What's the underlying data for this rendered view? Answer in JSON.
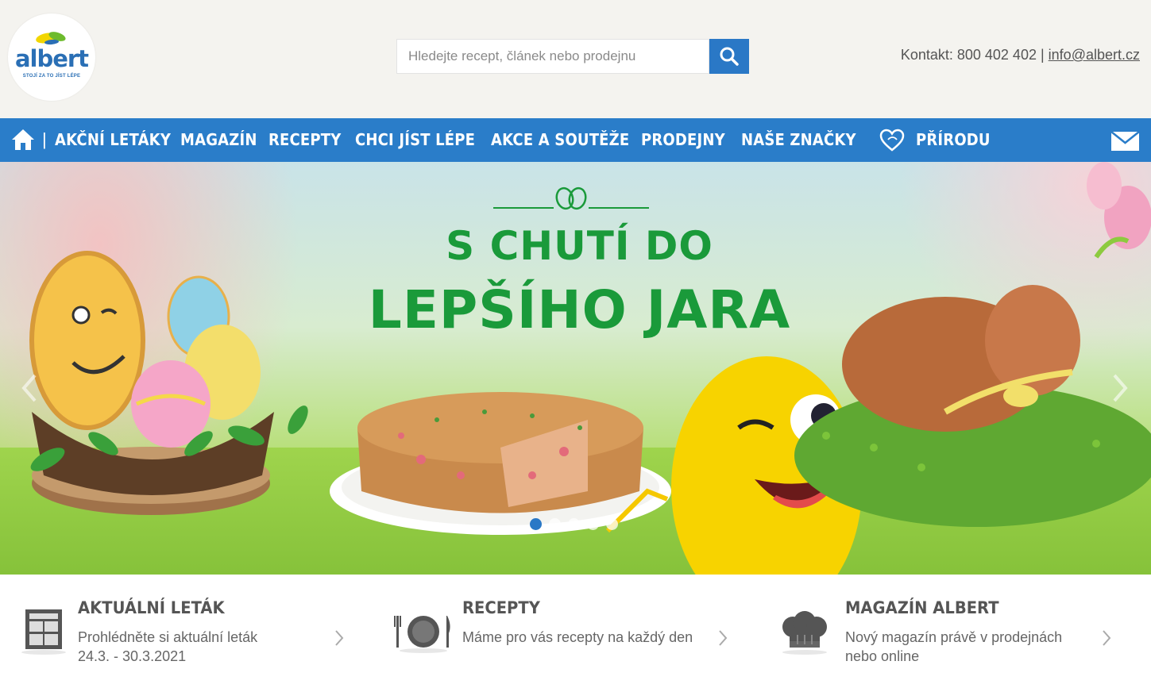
{
  "header": {
    "logo_word": "albert",
    "logo_tagline": "STOJÍ ZA TO JÍST LÉPE",
    "search_placeholder": "Hledejte recept, článek nebo prodejnu",
    "contact_label": "Kontakt: 800 402 402 |",
    "contact_email": "info@albert.cz"
  },
  "nav": {
    "separator": "|",
    "items": [
      "AKČNÍ LETÁKY",
      "MAGAZÍN",
      "RECEPTY",
      "CHCI JÍST LÉPE",
      "AKCE A SOUTĚŽE",
      "PRODEJNY",
      "NAŠE ZNAČKY",
      "PŘÍRODU"
    ]
  },
  "hero": {
    "title_line1": "S CHUTÍ DO",
    "title_line2": "LEPŠÍHO JARA",
    "slide_count": 5,
    "active_slide": 1,
    "title_color": "#1a9a3a"
  },
  "features": [
    {
      "icon": "flyer-icon",
      "title": "AKTUÁLNÍ LETÁK",
      "desc_line1": "Prohlédněte si aktuální leták",
      "desc_line2": "24.3. - 30.3.2021"
    },
    {
      "icon": "plate-cutlery-icon",
      "title": "RECEPTY",
      "desc_line1": "Máme pro vás recepty na každý den",
      "desc_line2": ""
    },
    {
      "icon": "chef-hat-icon",
      "title": "MAGAZÍN ALBERT",
      "desc_line1": "Nový magazín právě v prodejnách",
      "desc_line2": "nebo online"
    }
  ],
  "colors": {
    "brand_blue": "#2a7dc9",
    "background": "#f4f3ef"
  }
}
